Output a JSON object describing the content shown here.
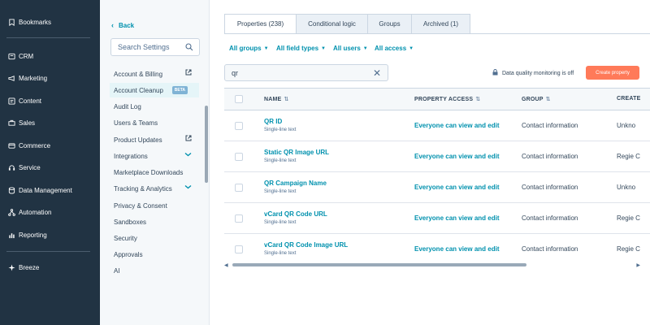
{
  "nav": {
    "items": [
      {
        "label": "Bookmarks",
        "icon": "bookmark-icon"
      },
      {
        "label": "CRM",
        "icon": "crm-icon"
      },
      {
        "label": "Marketing",
        "icon": "megaphone-icon"
      },
      {
        "label": "Content",
        "icon": "content-icon"
      },
      {
        "label": "Sales",
        "icon": "sales-icon"
      },
      {
        "label": "Commerce",
        "icon": "commerce-icon"
      },
      {
        "label": "Service",
        "icon": "service-icon"
      },
      {
        "label": "Data Management",
        "icon": "database-icon"
      },
      {
        "label": "Automation",
        "icon": "automation-icon"
      },
      {
        "label": "Reporting",
        "icon": "reporting-icon"
      },
      {
        "label": "Breeze",
        "icon": "sparkle-icon"
      }
    ]
  },
  "settings": {
    "back_label": "Back",
    "search_placeholder": "Search Settings",
    "menu": [
      {
        "label": "Account & Billing",
        "extra": "external-link-icon"
      },
      {
        "label": "Account Cleanup",
        "extra": "beta",
        "badge": "BETA"
      },
      {
        "label": "Audit Log"
      },
      {
        "label": "Users & Teams"
      },
      {
        "label": "Product Updates",
        "extra": "external-link-icon"
      },
      {
        "label": "Integrations",
        "extra": "chevron-down-icon"
      },
      {
        "label": "Marketplace Downloads"
      },
      {
        "label": "Tracking & Analytics",
        "extra": "chevron-down-icon"
      },
      {
        "label": "Privacy & Consent"
      },
      {
        "label": "Sandboxes"
      },
      {
        "label": "Security"
      },
      {
        "label": "Approvals"
      },
      {
        "label": "AI"
      }
    ]
  },
  "tabs": [
    {
      "label": "Properties (238)",
      "active": true
    },
    {
      "label": "Conditional logic"
    },
    {
      "label": "Groups"
    },
    {
      "label": "Archived (1)"
    }
  ],
  "filters": [
    "All groups",
    "All field types",
    "All users",
    "All access"
  ],
  "search": {
    "value": "qr"
  },
  "data_quality": "Data quality monitoring is off",
  "create_button": "Create property",
  "table": {
    "headers": [
      "NAME",
      "PROPERTY ACCESS",
      "GROUP",
      "CREATE"
    ],
    "rows": [
      {
        "name": "QR ID",
        "type": "Single-line text",
        "access": "Everyone can view and edit",
        "group": "Contact information",
        "creator": "Unkno"
      },
      {
        "name": "Static QR Image URL",
        "type": "Single-line text",
        "access": "Everyone can view and edit",
        "group": "Contact information",
        "creator": "Regie C"
      },
      {
        "name": "QR Campaign Name",
        "type": "Single-line text",
        "access": "Everyone can view and edit",
        "group": "Contact information",
        "creator": "Unkno"
      },
      {
        "name": "vCard QR Code URL",
        "type": "Single-line text",
        "access": "Everyone can view and edit",
        "group": "Contact information",
        "creator": "Regie C"
      },
      {
        "name": "vCard QR Code Image URL",
        "type": "Single-line text",
        "access": "Everyone can view and edit",
        "group": "Contact information",
        "creator": "Regie C"
      }
    ]
  },
  "colors": {
    "nav_bg": "#213343",
    "link": "#0091ae",
    "accent": "#ff7a59"
  }
}
